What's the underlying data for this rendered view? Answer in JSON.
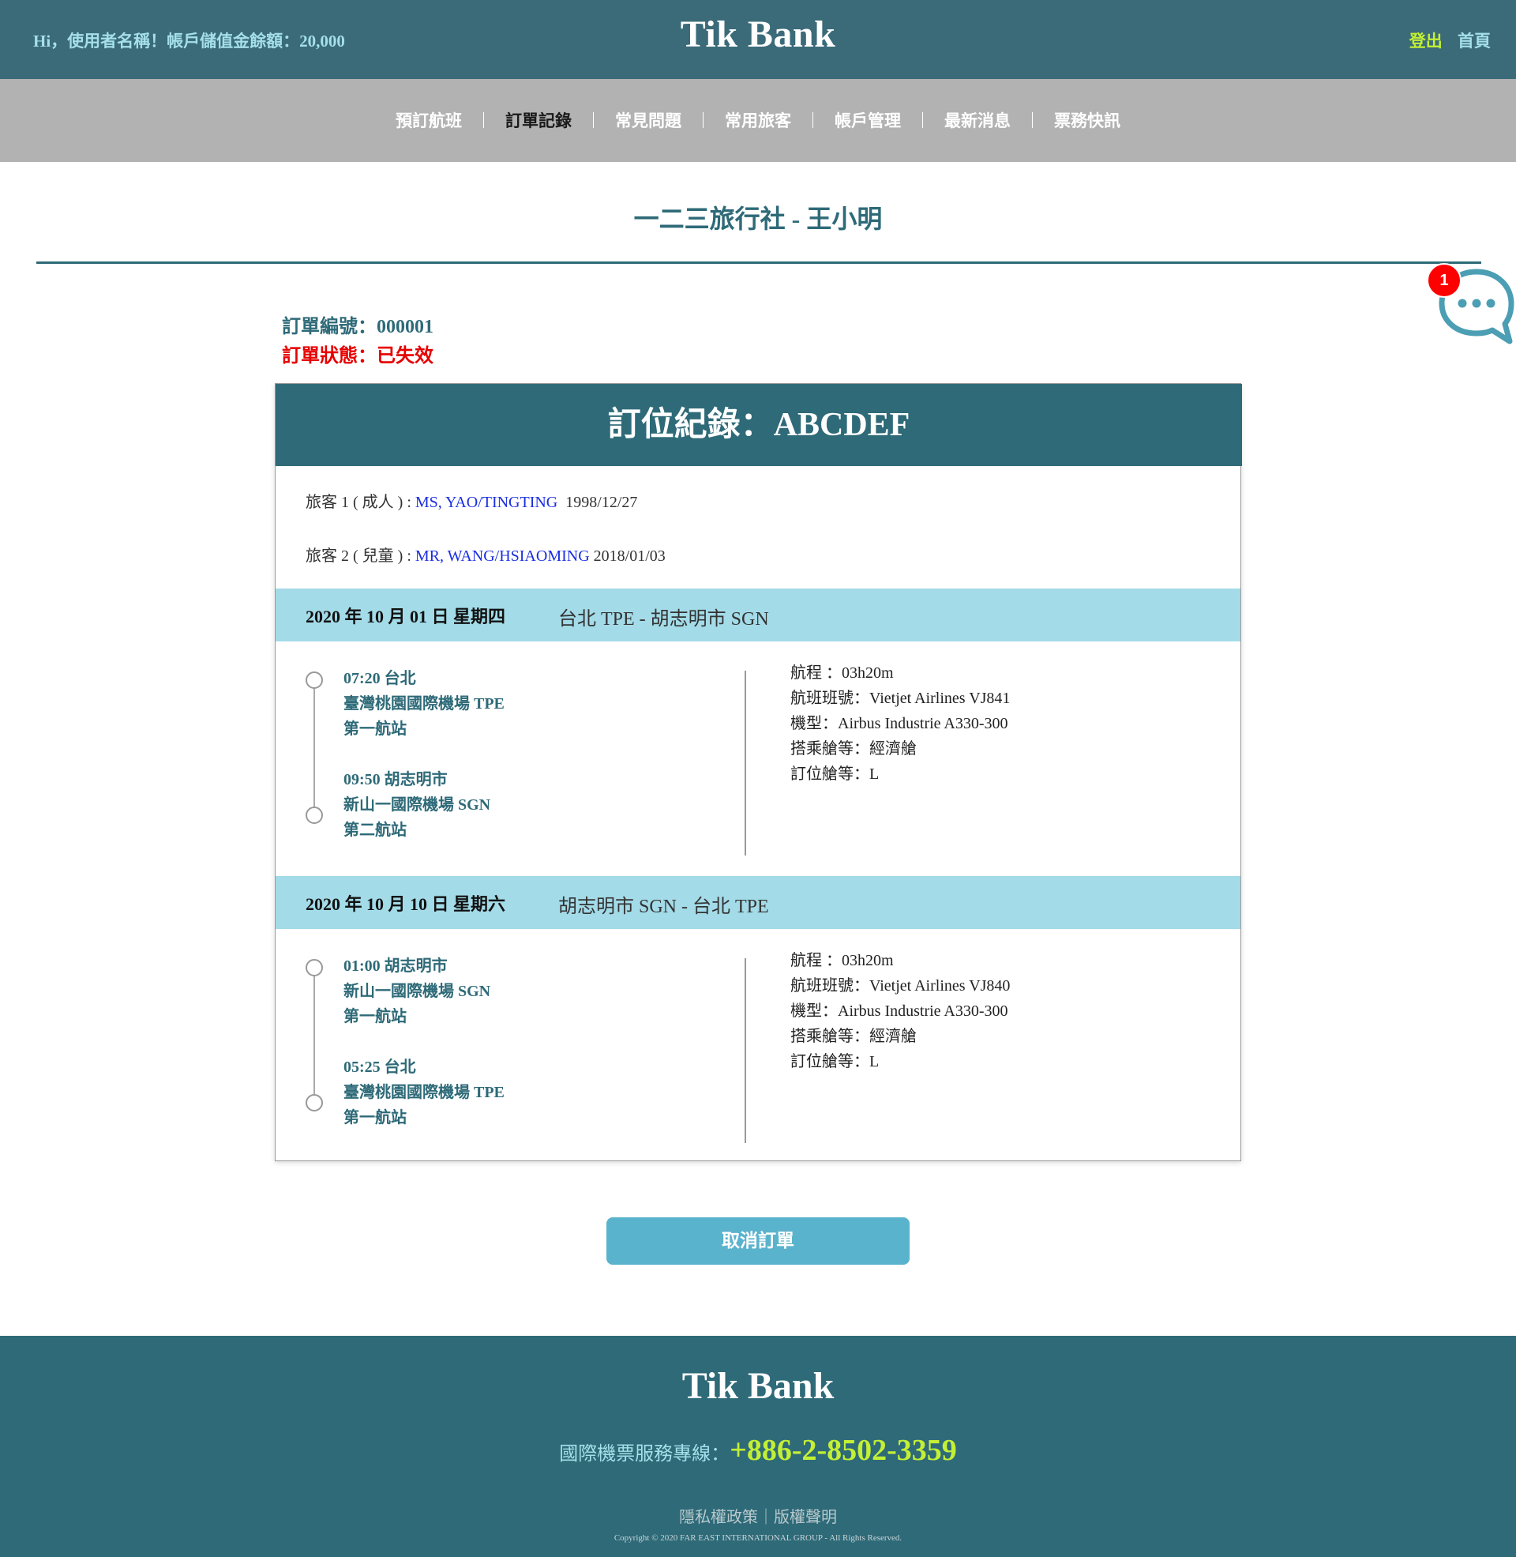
{
  "header": {
    "greeting": "Hi，使用者名稱！帳戶儲值金餘額：20,000",
    "brand": "Tik Bank",
    "logout_label": "登出",
    "home_label": "首頁"
  },
  "nav": {
    "items": [
      "預訂航班",
      "訂單記錄",
      "常見問題",
      "常用旅客",
      "帳戶管理",
      "最新消息",
      "票務快訊"
    ],
    "active": "訂單記錄"
  },
  "agency_title": "一二三旅行社 - 王小明",
  "chat": {
    "badge_count": "1",
    "icon": "chat-bubble-icon"
  },
  "order": {
    "number_text": "訂單編號：000001",
    "status_text": "訂單狀態：已失效"
  },
  "booking": {
    "title": "訂位紀錄：ABCDEF",
    "passengers": [
      {
        "prefix": "旅客 1 ( 成人 ) : ",
        "name": "MS, YAO/TINGTING",
        "dob": "1998/12/27"
      },
      {
        "prefix": "旅客 2 ( 兒童 ) : ",
        "name": "MR, WANG/HSIAOMING",
        "dob": "2018/01/03"
      }
    ],
    "segments": [
      {
        "date": "2020 年 10 月 01 日 星期四",
        "route": "台北 TPE - 胡志明市 SGN",
        "depart": {
          "time_city": "07:20 台北",
          "airport": "臺灣桃園國際機場 TPE",
          "terminal": "第一航站"
        },
        "arrive": {
          "time_city": "09:50 胡志明市",
          "airport": "新山一國際機場 SGN",
          "terminal": "第二航站"
        },
        "details": [
          "航程 ：03h20m",
          "航班班號：Vietjet Airlines VJ841",
          "機型：Airbus Industrie A330-300",
          "搭乘艙等：經濟艙",
          "訂位艙等：L"
        ]
      },
      {
        "date": "2020 年 10 月 10 日 星期六",
        "route": "胡志明市 SGN - 台北 TPE",
        "depart": {
          "time_city": "01:00 胡志明市",
          "airport": "新山一國際機場 SGN",
          "terminal": "第一航站"
        },
        "arrive": {
          "time_city": "05:25 台北",
          "airport": "臺灣桃園國際機場 TPE",
          "terminal": "第一航站"
        },
        "details": [
          "航程 ：03h20m",
          "航班班號：Vietjet Airlines VJ840",
          "機型：Airbus Industrie A330-300",
          "搭乘艙等：經濟艙",
          "訂位艙等：L"
        ]
      }
    ]
  },
  "cancel_label": "取消訂單",
  "footer": {
    "brand": "Tik Bank",
    "hotline_label": "國際機票服務專線：",
    "hotline_number": "+886-2-8502-3359",
    "privacy_label": "隱私權政策",
    "separator": "｜",
    "copyright_label": "版權聲明",
    "copyright_text": "Copyright © 2020 FAR EAST INTERNATIONAL GROUP - All Rights Reserved."
  },
  "colors": {
    "header_bg": "#3b6b79",
    "nav_bg": "#b2b2b2",
    "primary": "#2e6a78",
    "segment_bar": "#a3dbe8",
    "accent_green": "#c3ef35",
    "status_red": "#e60000",
    "button": "#5ab3cd"
  }
}
